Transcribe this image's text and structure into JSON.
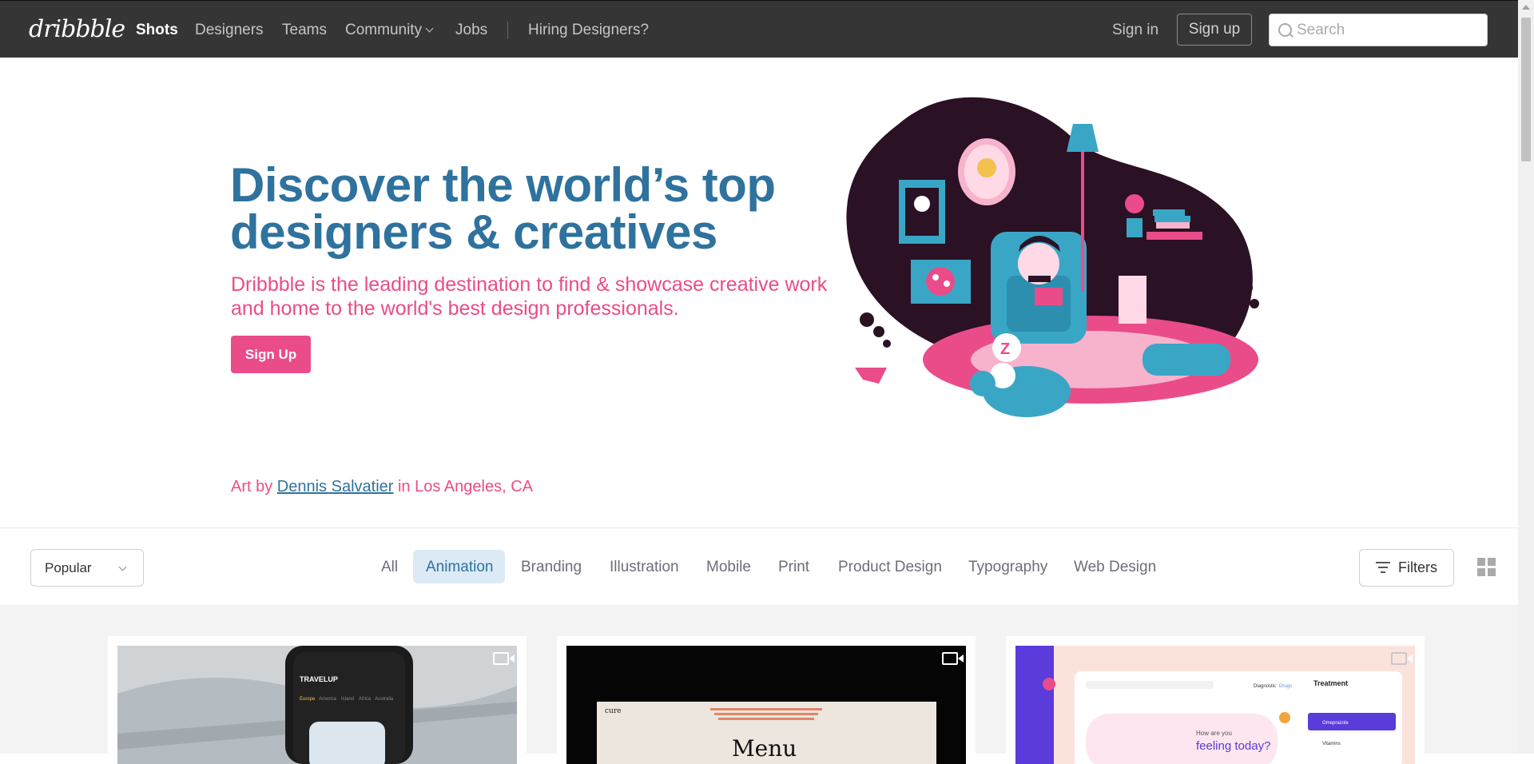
{
  "nav": {
    "logo": "dribbble",
    "links": [
      "Shots",
      "Designers",
      "Teams",
      "Community",
      "Jobs",
      "Hiring Designers?"
    ],
    "sign_in": "Sign in",
    "sign_up": "Sign up",
    "search_placeholder": "Search"
  },
  "hero": {
    "title": "Discover the world’s top designers & creatives",
    "subtitle": "Dribbble is the leading destination to find & showcase creative work and home to the world's best design professionals.",
    "cta": "Sign Up",
    "credit_prefix": "Art by ",
    "credit_artist": "Dennis Salvatier",
    "credit_suffix": " in Los Angeles, CA"
  },
  "filter_bar": {
    "sort_selected": "Popular",
    "categories": [
      "All",
      "Animation",
      "Branding",
      "Illustration",
      "Mobile",
      "Print",
      "Product Design",
      "Typography",
      "Web Design"
    ],
    "active_category": "Animation",
    "filters_label": "Filters"
  },
  "shots": {
    "card2": {
      "brand": "cure",
      "menu_title": "Menu"
    },
    "card1": {
      "brand": "TRAVELUP",
      "tabs": [
        "Europe",
        "America",
        "Island",
        "Africa",
        "Australia"
      ]
    },
    "card3": {
      "title": "Treatment",
      "greeting": "How are you",
      "feeling": "feeling today?",
      "tabs": [
        "Diagnostic",
        "Drugs"
      ],
      "items": [
        "Omeprazole",
        "Vitamins"
      ]
    }
  },
  "colors": {
    "nav_bg": "#353535",
    "hero_title": "#2f729e",
    "accent_pink": "#ea4c89",
    "active_pill": "#dbeaf5"
  }
}
